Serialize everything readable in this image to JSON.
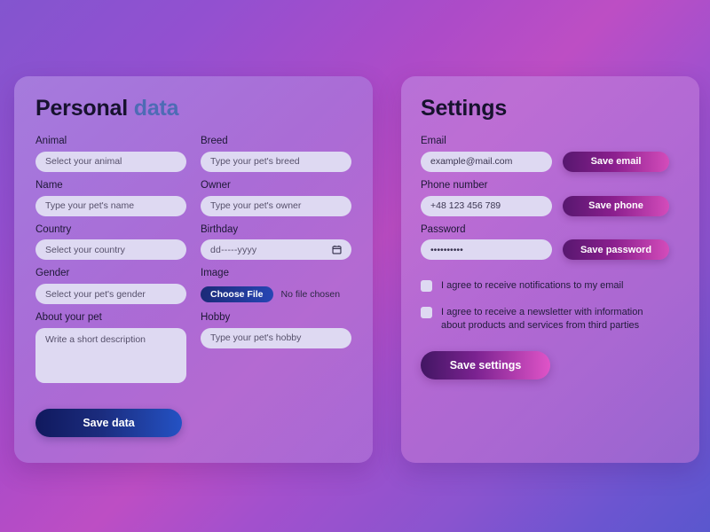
{
  "personal_card": {
    "title_primary": "Personal",
    "title_accent": "data",
    "left_fields": [
      {
        "label": "Animal",
        "placeholder": "Select your animal"
      },
      {
        "label": "Name",
        "placeholder": "Type your pet's name"
      },
      {
        "label": "Country",
        "placeholder": "Select your country"
      },
      {
        "label": "Gender",
        "placeholder": "Select your pet's gender"
      },
      {
        "label": "About your pet",
        "placeholder": "Write a short description"
      }
    ],
    "right_fields": [
      {
        "label": "Breed",
        "placeholder": "Type your pet's breed"
      },
      {
        "label": "Owner",
        "placeholder": "Type your pet's owner"
      },
      {
        "label": "Birthday",
        "placeholder": "dd-----yyyy"
      },
      {
        "label": "Image"
      },
      {
        "label": "Hobby",
        "placeholder": "Type your pet's hobby"
      }
    ],
    "choose_file_label": "Choose File",
    "file_status": "No file chosen",
    "save_label": "Save data"
  },
  "settings_card": {
    "title": "Settings",
    "rows": [
      {
        "label": "Email",
        "value": "example@mail.com",
        "button": "Save email"
      },
      {
        "label": "Phone number",
        "value": "+48 123 456 789",
        "button": "Save phone"
      },
      {
        "label": "Password",
        "value": "••••••••••",
        "button": "Save password"
      }
    ],
    "checkboxes": [
      {
        "label": "I agree to receive notifications to my email",
        "checked": false
      },
      {
        "label": "I agree to receive a newsletter with information about products and services from third parties",
        "checked": false
      }
    ],
    "save_label": "Save settings"
  },
  "colors": {
    "background_start": "#8355cf",
    "background_mid": "#bd4ec4",
    "background_end": "#5a57ce",
    "card_fill": "#b08ae2",
    "input_fill": "#ded9f2",
    "title_accent": "#4e6bb5",
    "save_data_gradient_start": "#10195e",
    "save_data_gradient_end": "#2452c4",
    "save_settings_gradient_start": "#421663",
    "save_settings_gradient_end": "#e054c8"
  }
}
